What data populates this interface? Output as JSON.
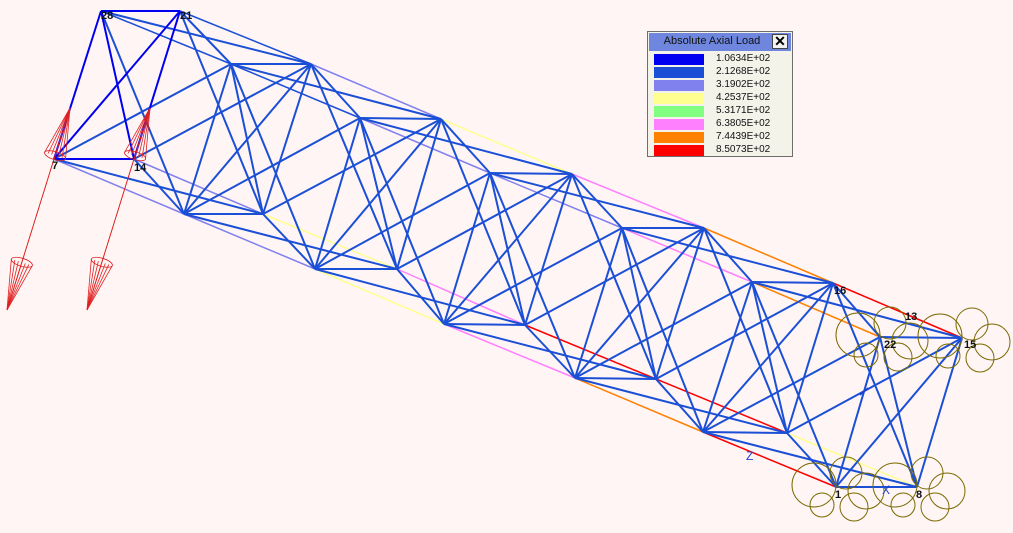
{
  "legend": {
    "title": "Absolute Axial Load",
    "close_symbol": "✕",
    "entries": [
      {
        "label": "1.0634E+02",
        "color": "#0000f0"
      },
      {
        "label": "2.1268E+02",
        "color": "#1a4fd6"
      },
      {
        "label": "3.1902E+02",
        "color": "#8080ee"
      },
      {
        "label": "4.2537E+02",
        "color": "#ffff90"
      },
      {
        "label": "5.3171E+02",
        "color": "#80ff80"
      },
      {
        "label": "6.3805E+02",
        "color": "#ff80ff"
      },
      {
        "label": "7.4439E+02",
        "color": "#ff8000"
      },
      {
        "label": "8.5073E+02",
        "color": "#ff0000"
      }
    ]
  },
  "nodes": {
    "n28": "28",
    "n21": "21",
    "n7": "7",
    "n14": "14",
    "n16": "16",
    "n13": "13",
    "n22": "22",
    "n15": "15",
    "n1": "1",
    "n8": "8"
  },
  "axes": {
    "x": "X",
    "z": "Z"
  },
  "icons": {
    "load_arrow": "load-arrow-icon",
    "support": "support-spring-icon"
  }
}
